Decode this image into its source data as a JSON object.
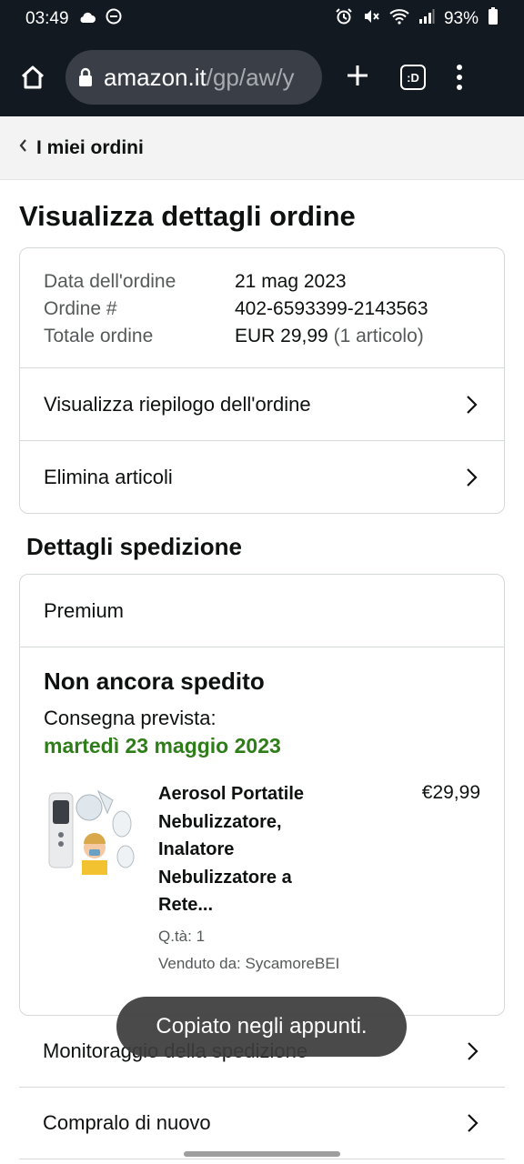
{
  "status_bar": {
    "time": "03:49",
    "battery": "93%"
  },
  "browser": {
    "url_host": "amazon.it",
    "url_path": "/gp/aw/y",
    "tabs_label": ":D"
  },
  "subnav": {
    "label": "I miei ordini"
  },
  "page": {
    "title": "Visualizza dettagli ordine"
  },
  "order_summary": {
    "date_label": "Data dell'ordine",
    "date_value": "21 mag 2023",
    "number_label": "Ordine #",
    "number_value": "402-6593399-2143563",
    "total_label": "Totale ordine",
    "total_value": "EUR 29,99",
    "total_items": "(1 articolo)"
  },
  "actions": {
    "view_summary": "Visualizza riepilogo dell'ordine",
    "delete_items": "Elimina articoli"
  },
  "shipping": {
    "section_title": "Dettagli spedizione",
    "type": "Premium",
    "status": "Non ancora spedito",
    "delivery_label": "Consegna prevista:",
    "delivery_date": "martedì 23 maggio 2023",
    "item": {
      "title": "Aerosol Portatile Nebulizzatore, Inalatore Nebulizzatore a Rete...",
      "qty": "Q.tà: 1",
      "seller": "Venduto da: SycamoreBEI",
      "price": "€29,99"
    }
  },
  "bottom_links": {
    "tracking": "Monitoraggio della spedizione",
    "buy_again": "Compralo di nuovo"
  },
  "toast": {
    "text": "Copiato negli appunti."
  },
  "colors": {
    "header_bg": "#131921",
    "delivery_green": "#2f7d1a",
    "border": "#d5d9d9"
  }
}
